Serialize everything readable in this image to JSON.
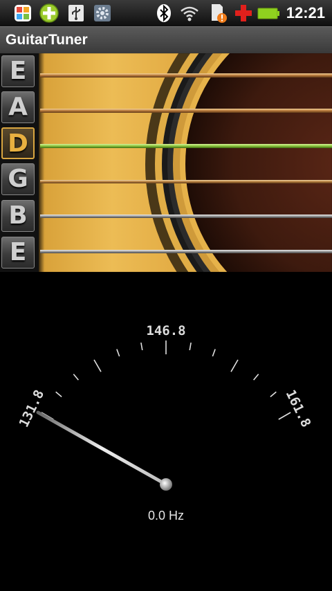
{
  "status_bar": {
    "time": "12:21",
    "icons": [
      "multicolor-app-icon",
      "add-plus-icon",
      "usb-icon",
      "settings-gear-icon",
      "bluetooth-icon",
      "wifi-icon",
      "sd-card-alert-icon",
      "red-cross-icon",
      "battery-icon"
    ]
  },
  "app": {
    "title": "GuitarTuner"
  },
  "strings": [
    {
      "note": "E",
      "active": false
    },
    {
      "note": "A",
      "active": false
    },
    {
      "note": "D",
      "active": true
    },
    {
      "note": "G",
      "active": false
    },
    {
      "note": "B",
      "active": false
    },
    {
      "note": "E",
      "active": false
    }
  ],
  "colors": {
    "active_string": "#8cc63f",
    "active_note": "#e8b040",
    "wood": "#e8b850"
  },
  "tuner": {
    "center_label": "146.8",
    "min_label": "131.8",
    "max_label": "161.8",
    "readout": "0.0 Hz",
    "needle_value_hz": 131.8
  }
}
